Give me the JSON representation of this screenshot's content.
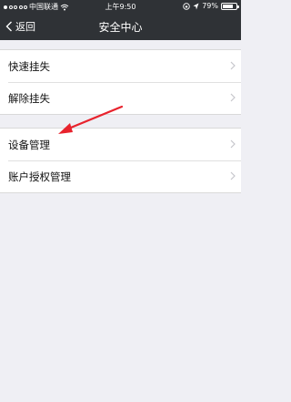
{
  "status_bar": {
    "carrier": "中国联通",
    "time": "上午9:50",
    "battery": "79%",
    "battery_level": 0.79
  },
  "nav": {
    "back_label": "返回",
    "title": "安全中心"
  },
  "groups": [
    {
      "items": [
        {
          "label": "快速挂失"
        },
        {
          "label": "解除挂失"
        }
      ]
    },
    {
      "items": [
        {
          "label": "设备管理"
        },
        {
          "label": "账户授权管理"
        }
      ]
    }
  ],
  "colors": {
    "navbar": "#2f3236",
    "background": "#efeff4",
    "annotation_arrow": "#e8232d"
  }
}
